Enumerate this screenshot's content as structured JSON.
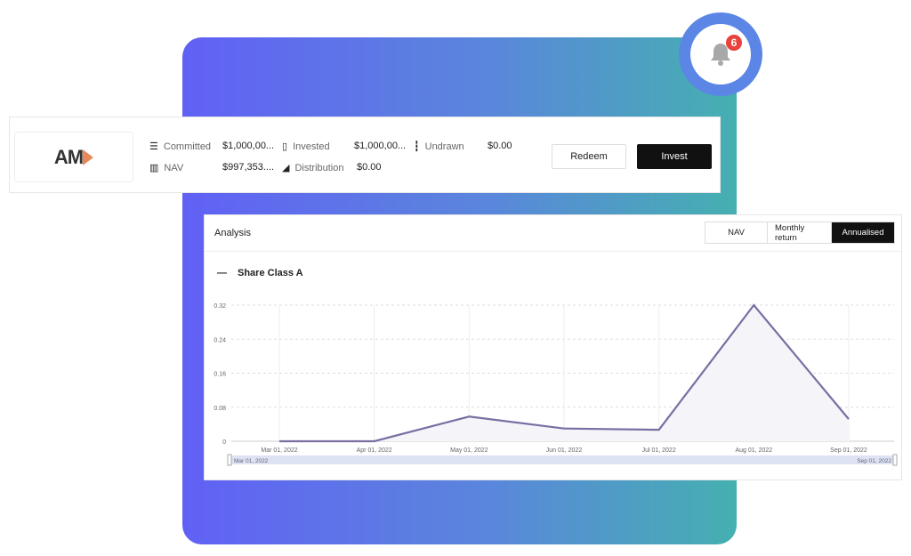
{
  "notifications": {
    "count": "6"
  },
  "fund": {
    "logo_text": "AM",
    "stats": [
      {
        "label": "Committed",
        "value": "$1,000,00...",
        "icon": "sliders-icon"
      },
      {
        "label": "Invested",
        "value": "$1,000,00...",
        "icon": "document-icon"
      },
      {
        "label": "Undrawn",
        "value": "$0.00",
        "icon": "candlestick-icon"
      },
      {
        "label": "NAV",
        "value": "$997,353....",
        "icon": "bar-chart-icon"
      },
      {
        "label": "Distribution",
        "value": "$0.00",
        "icon": "growth-chart-icon"
      }
    ],
    "redeem_label": "Redeem",
    "invest_label": "Invest"
  },
  "analysis": {
    "title": "Analysis",
    "tabs": [
      {
        "label": "NAV"
      },
      {
        "label": "Monthly return"
      },
      {
        "label": "Annualised",
        "active": true
      }
    ],
    "share_class": "Share Class A",
    "range_start": "Mar 01, 2022",
    "range_end": "Sep 01, 2022"
  },
  "colors": {
    "line": "#7a6ea3",
    "accent": "#5b86e6",
    "badge": "#e8423a"
  },
  "chart_data": {
    "type": "area",
    "categories": [
      "Mar 01, 2022",
      "Apr 01, 2022",
      "May 01, 2022",
      "Jun 01, 2022",
      "Jul 01, 2022",
      "Aug 01, 2022",
      "Sep 01, 2022"
    ],
    "values": [
      0,
      0,
      0.058,
      0.03,
      0.027,
      0.32,
      0.052
    ],
    "yticks": [
      "0",
      "0.08",
      "0.16",
      "0.24",
      "0.32"
    ],
    "ylim": [
      0,
      0.32
    ],
    "grid": true
  }
}
